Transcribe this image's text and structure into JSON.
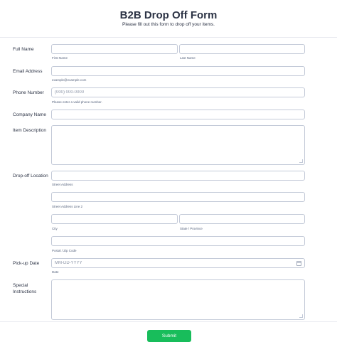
{
  "header": {
    "title": "B2B Drop Off Form",
    "subtitle": "Please fill out this form to drop off your items."
  },
  "fields": {
    "full_name": {
      "label": "Full Name",
      "first_sub": "First Name",
      "last_sub": "Last Name"
    },
    "email": {
      "label": "Email Address",
      "sub": "example@example.com"
    },
    "phone": {
      "label": "Phone Number",
      "placeholder": "(000) 000-0000",
      "sub": "Please enter a valid phone number."
    },
    "company": {
      "label": "Company Name"
    },
    "item_description": {
      "label": "Item Description"
    },
    "dropoff_location": {
      "label": "Drop-off Location",
      "street_sub": "Street Address",
      "street2_sub": "Street Address Line 2",
      "city_sub": "City",
      "state_sub": "State / Province",
      "postal_sub": "Postal / Zip Code"
    },
    "pickup_date": {
      "label": "Pick-up Date",
      "placeholder": "MM-DD-YYYY",
      "sub": "Date"
    },
    "special_instructions": {
      "label": "Special Instructions"
    }
  },
  "submit": {
    "label": "Submit"
  },
  "colors": {
    "accent": "#18bd5b",
    "text": "#2c3345",
    "border": "#c3cad8"
  }
}
